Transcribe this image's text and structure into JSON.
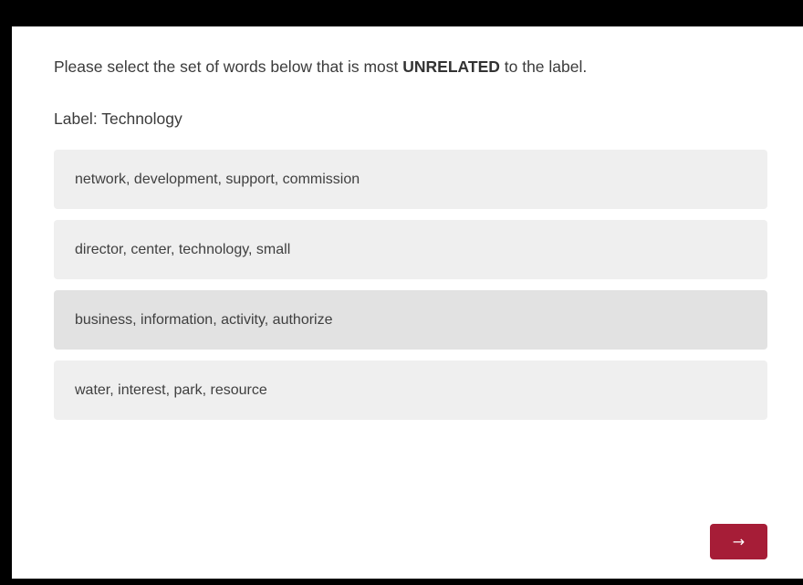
{
  "question": {
    "prefix": "Please select the set of words below that is most ",
    "emphasis": "UNRELATED",
    "suffix": " to the label."
  },
  "label": {
    "text": "Label: Technology"
  },
  "options": [
    {
      "text": "network, development, support, commission"
    },
    {
      "text": "director, center, technology, small"
    },
    {
      "text": "business, information, activity, authorize"
    },
    {
      "text": "water, interest, park, resource"
    }
  ],
  "next_button": {
    "icon": "arrow-right-icon",
    "glyph": "→"
  },
  "colors": {
    "accent": "#a61d37",
    "option_bg": "#efefef",
    "option_hover_bg": "#e2e2e2",
    "text": "#3b3b3b"
  }
}
